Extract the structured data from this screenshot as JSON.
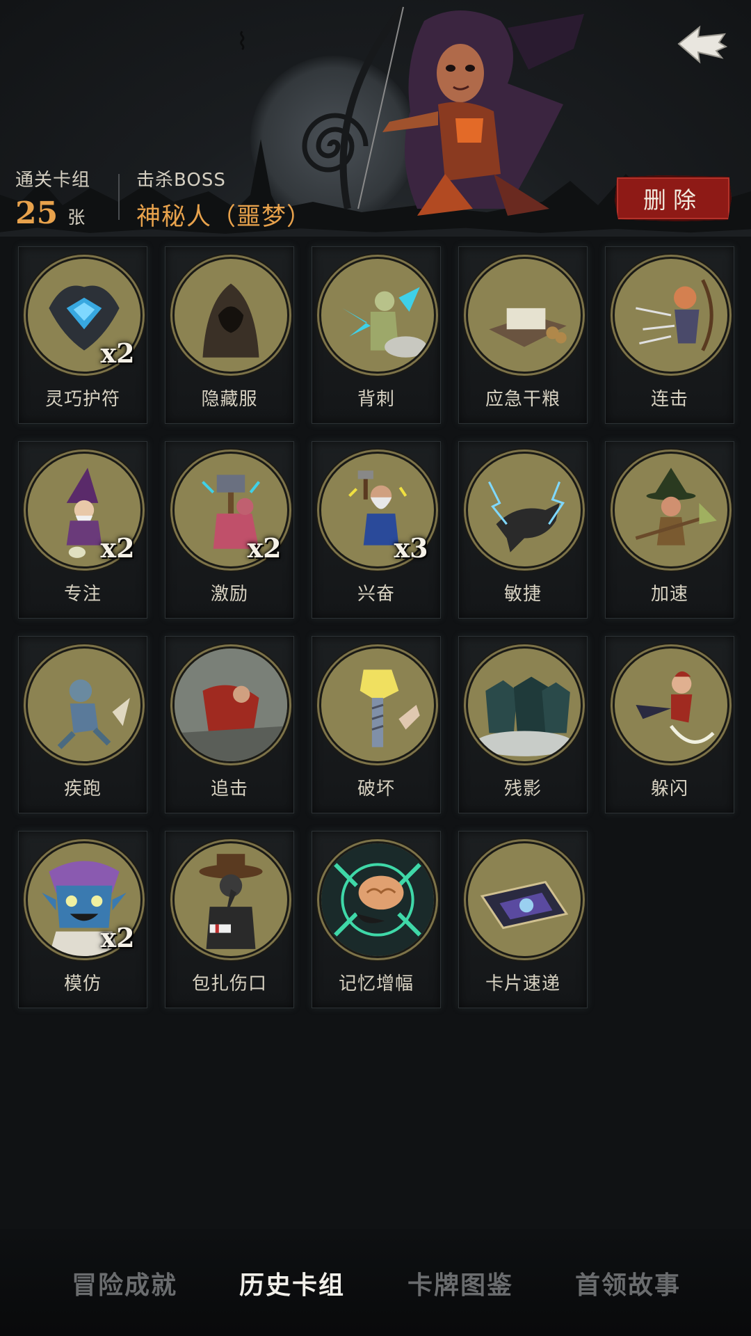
{
  "header": {
    "deck_label": "通关卡组",
    "deck_count": "25",
    "deck_unit": "张",
    "boss_label": "击杀BOSS",
    "boss_name": "神秘人（噩梦）",
    "delete_label": "删除",
    "accent_color": "#e8a24c",
    "delete_color": "#8e1a16"
  },
  "cards": [
    {
      "name": "灵巧护符",
      "count": "x2",
      "icon": "amulet-icon"
    },
    {
      "name": "隐藏服",
      "count": "",
      "icon": "hooded-cloak-icon"
    },
    {
      "name": "背刺",
      "count": "",
      "icon": "backstab-icon"
    },
    {
      "name": "应急干粮",
      "count": "",
      "icon": "rations-icon"
    },
    {
      "name": "连击",
      "count": "",
      "icon": "archer-icon"
    },
    {
      "name": "专注",
      "count": "x2",
      "icon": "wizard-icon"
    },
    {
      "name": "激励",
      "count": "x2",
      "icon": "hammer-warrior-icon"
    },
    {
      "name": "兴奋",
      "count": "x3",
      "icon": "dwarf-icon"
    },
    {
      "name": "敏捷",
      "count": "",
      "icon": "panther-icon"
    },
    {
      "name": "加速",
      "count": "",
      "icon": "witch-icon"
    },
    {
      "name": "疾跑",
      "count": "",
      "icon": "running-goblin-icon"
    },
    {
      "name": "追击",
      "count": "",
      "icon": "red-cloak-icon"
    },
    {
      "name": "破坏",
      "count": "",
      "icon": "broken-bolt-icon"
    },
    {
      "name": "残影",
      "count": "",
      "icon": "shadow-clones-icon"
    },
    {
      "name": "躲闪",
      "count": "",
      "icon": "dodge-icon"
    },
    {
      "name": "模仿",
      "count": "x2",
      "icon": "goblin-face-icon"
    },
    {
      "name": "包扎伤口",
      "count": "",
      "icon": "plague-doctor-icon"
    },
    {
      "name": "记忆增幅",
      "count": "",
      "icon": "brain-icon"
    },
    {
      "name": "卡片速递",
      "count": "",
      "icon": "card-icon"
    }
  ],
  "tabs": [
    {
      "label": "冒险成就",
      "active": false
    },
    {
      "label": "历史卡组",
      "active": true
    },
    {
      "label": "卡牌图鉴",
      "active": false
    },
    {
      "label": "首领故事",
      "active": false
    }
  ]
}
